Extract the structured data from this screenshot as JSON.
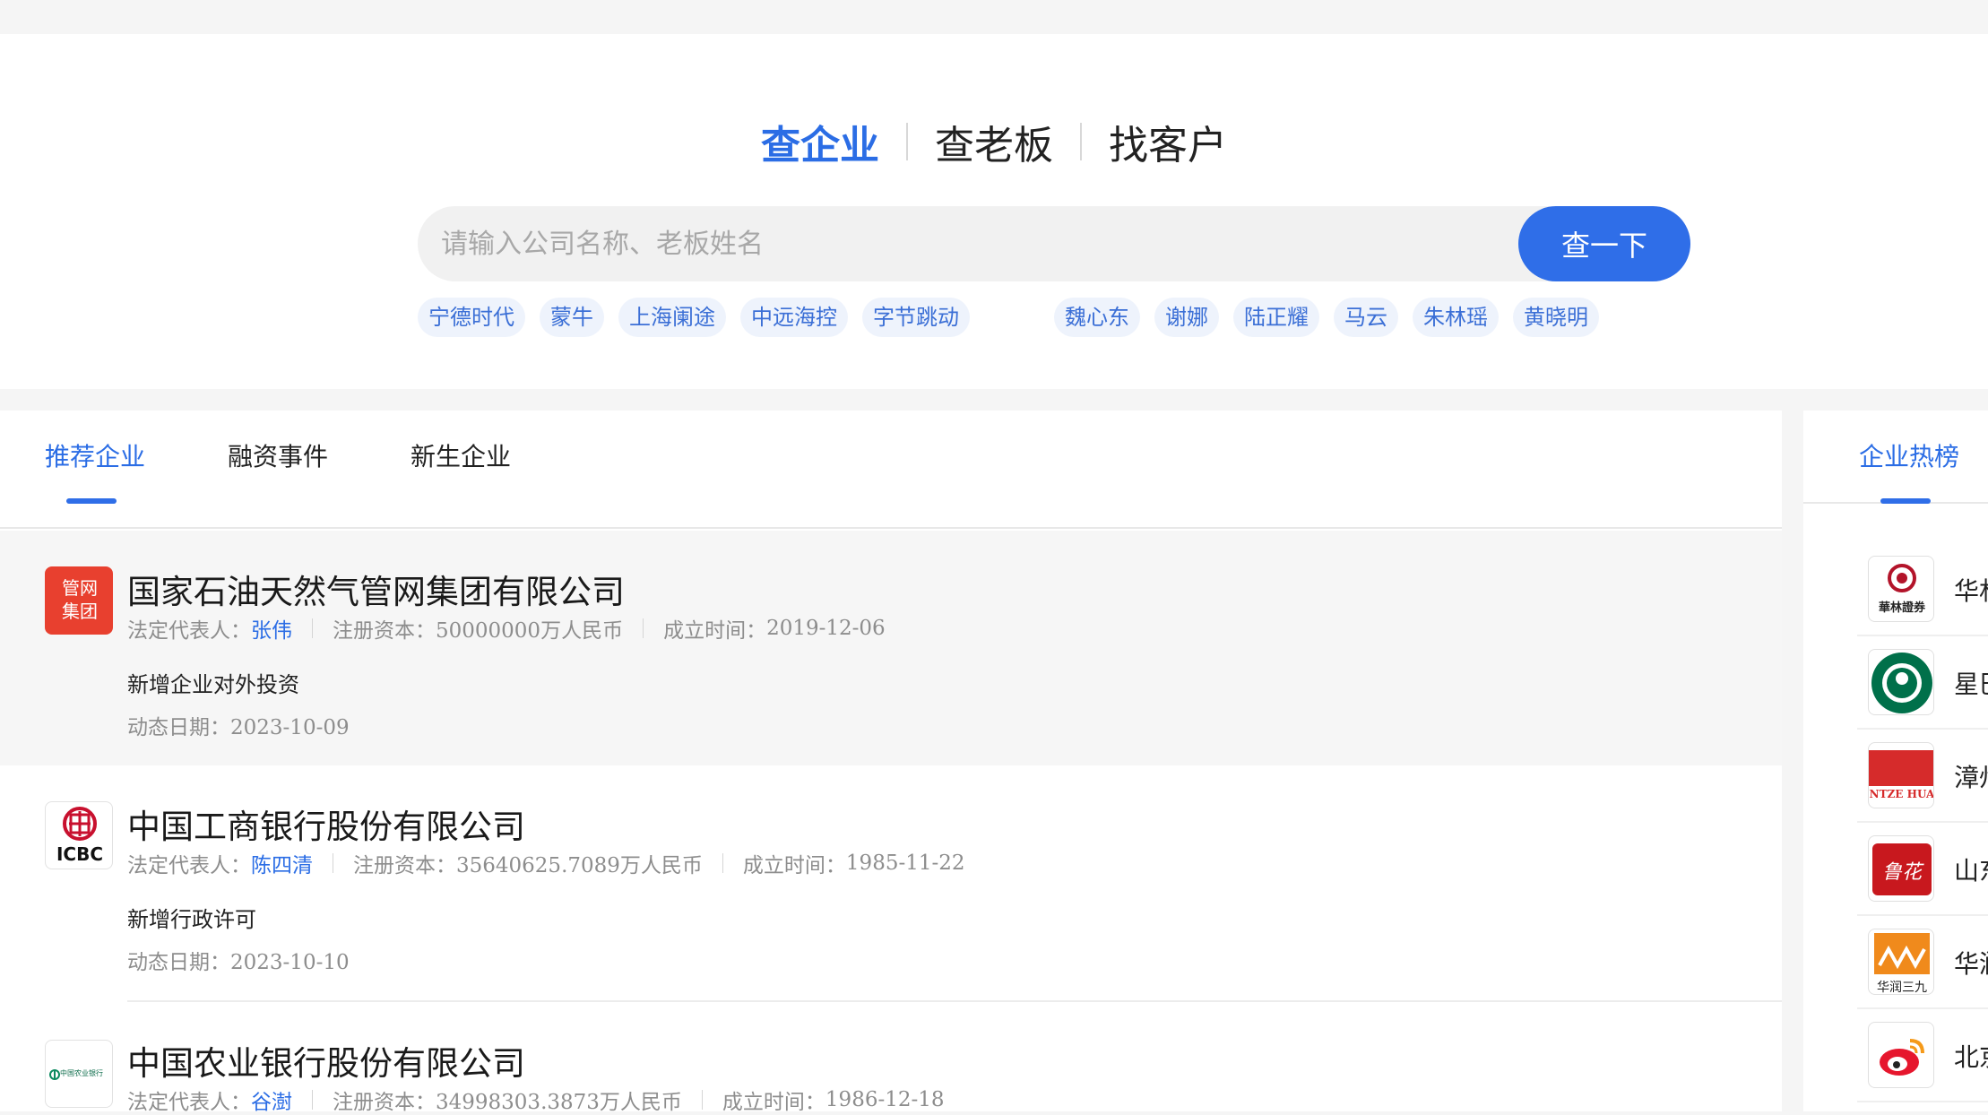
{
  "search": {
    "mode_tabs": [
      "查企业",
      "查老板",
      "找客户"
    ],
    "placeholder": "请输入公司名称、老板姓名",
    "button_label": "查一下",
    "hot_companies": [
      "宁德时代",
      "蒙牛",
      "上海阑途",
      "中远海控",
      "字节跳动"
    ],
    "hot_people": [
      "魏心东",
      "谢娜",
      "陆正耀",
      "马云",
      "朱林瑶",
      "黄晓明"
    ]
  },
  "list": {
    "tabs": [
      "推荐企业",
      "融资事件",
      "新生企业"
    ],
    "rep_label": "法定代表人：",
    "capital_label": "注册资本：",
    "founded_label": "成立时间：",
    "date_label": "动态日期：",
    "items": [
      {
        "name": "国家石油天然气管网集团有限公司",
        "logo_text_1": "管网",
        "logo_text_2": "集团",
        "rep": "张伟",
        "capital": "50000000万人民币",
        "founded": "2019-12-06",
        "event": "新增企业对外投资",
        "date": "2023-10-09"
      },
      {
        "name": "中国工商银行股份有限公司",
        "logo_text_1": "ICBC",
        "rep": "陈四清",
        "capital": "35640625.7089万人民币",
        "founded": "1985-11-22",
        "event": "新增行政许可",
        "date": "2023-10-10"
      },
      {
        "name": "中国农业银行股份有限公司",
        "logo_text_1": "中国农业银行",
        "rep": "谷澍",
        "capital": "34998303.3873万人民币",
        "founded": "1986-12-18"
      }
    ]
  },
  "side": {
    "title": "企业热榜",
    "items": [
      {
        "name": "华林",
        "logo_text": "華林證券",
        "icon": "hualin-securities-logo-icon"
      },
      {
        "name": "星巴",
        "icon": "starbucks-logo-icon"
      },
      {
        "name": "漳州",
        "logo_text": "NTZE HUA",
        "icon": "pientzehuang-logo-icon"
      },
      {
        "name": "山东",
        "logo_text": "鲁花",
        "icon": "luhua-logo-icon"
      },
      {
        "name": "华润",
        "logo_text": "华润三九",
        "icon": "china-resources-999-logo-icon"
      },
      {
        "name": "北京",
        "icon": "weibo-logo-icon"
      }
    ]
  },
  "colors": {
    "accent": "#2f6ee8",
    "tag_bg": "#eef3fc",
    "page_bg": "#f5f5f5",
    "pipechina_red": "#e8402f",
    "icbc_red": "#c8102e"
  }
}
